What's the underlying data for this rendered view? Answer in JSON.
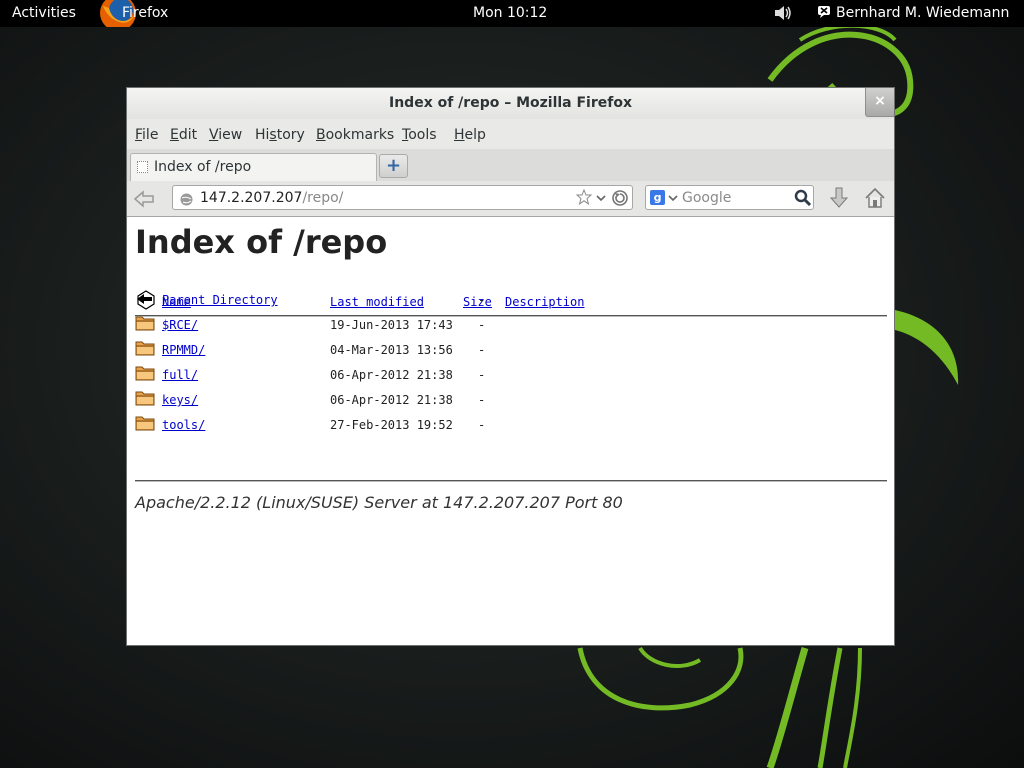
{
  "topbar": {
    "activities": "Activities",
    "app_name": "Firefox",
    "clock": "Mon 10:12",
    "user_name": "Bernhard M. Wiedemann"
  },
  "window": {
    "title": "Index of /repo – Mozilla Firefox",
    "close_glyph": "×"
  },
  "menubar": {
    "items": [
      {
        "label": "File",
        "accel": "F"
      },
      {
        "label": "Edit",
        "accel": "E"
      },
      {
        "label": "View",
        "accel": "V"
      },
      {
        "label": "History",
        "accel": "s"
      },
      {
        "label": "Bookmarks",
        "accel": "B"
      },
      {
        "label": "Tools",
        "accel": "T"
      },
      {
        "label": "Help",
        "accel": "H"
      }
    ]
  },
  "tabs": {
    "active_label": "Index of /repo",
    "new_tab_glyph": "+"
  },
  "navbar": {
    "url_host": "147.2.207.207",
    "url_path": "/repo/",
    "search_engine_glyph": "g",
    "search_placeholder": "Google"
  },
  "page": {
    "heading": "Index of /repo",
    "columns": {
      "name": "Name",
      "last_modified": "Last modified",
      "size": "Size",
      "description": "Description"
    },
    "rows": [
      {
        "icon": "back-icon",
        "name": "Parent Directory",
        "date": "",
        "size": "-"
      },
      {
        "icon": "folder-icon",
        "name": "$RCE/",
        "date": "19-Jun-2013 17:43",
        "size": "-"
      },
      {
        "icon": "folder-icon",
        "name": "RPMMD/",
        "date": "04-Mar-2013 13:56",
        "size": "-"
      },
      {
        "icon": "folder-icon",
        "name": "full/",
        "date": "06-Apr-2012 21:38",
        "size": "-"
      },
      {
        "icon": "folder-icon",
        "name": "keys/",
        "date": "06-Apr-2012 21:38",
        "size": "-"
      },
      {
        "icon": "folder-icon",
        "name": "tools/",
        "date": "27-Feb-2013 19:52",
        "size": "-"
      }
    ],
    "signature": "Apache/2.2.12 (Linux/SUSE) Server at 147.2.207.207 Port 80"
  },
  "colors": {
    "link": "#0000cc",
    "wallpaper_swirl": "#73ba25",
    "topbar": "#000000"
  }
}
